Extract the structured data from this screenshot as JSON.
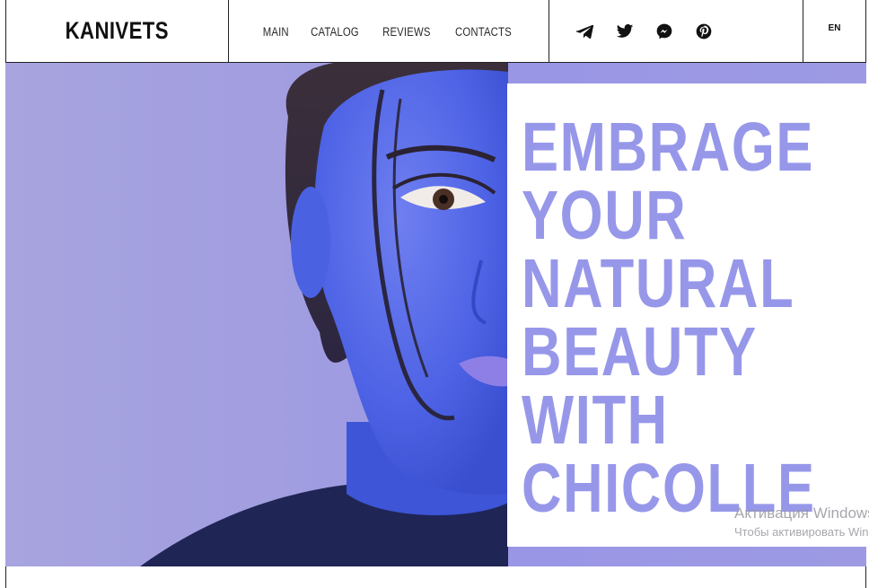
{
  "brand": {
    "logo": "KANIVETS"
  },
  "nav": {
    "items": [
      {
        "label": "MAIN"
      },
      {
        "label": "CATALOG"
      },
      {
        "label": "REVIEWS"
      },
      {
        "label": "CONTACTS"
      }
    ]
  },
  "social": {
    "items": [
      {
        "icon": "telegram-icon"
      },
      {
        "icon": "twitter-icon"
      },
      {
        "icon": "messenger-icon"
      },
      {
        "icon": "pinterest-icon"
      }
    ]
  },
  "language": {
    "current": "EN"
  },
  "hero": {
    "headline_lines": [
      "EMBRAGE",
      "YOUR",
      "NATURAL",
      "BEAUTY",
      "WITH",
      "CHICOLLE"
    ],
    "headline_color": "#9797ea",
    "background_color": "#a29ee0"
  },
  "os_watermark": {
    "title": "Активация Windows",
    "subtitle": "Чтобы активировать Windows"
  }
}
